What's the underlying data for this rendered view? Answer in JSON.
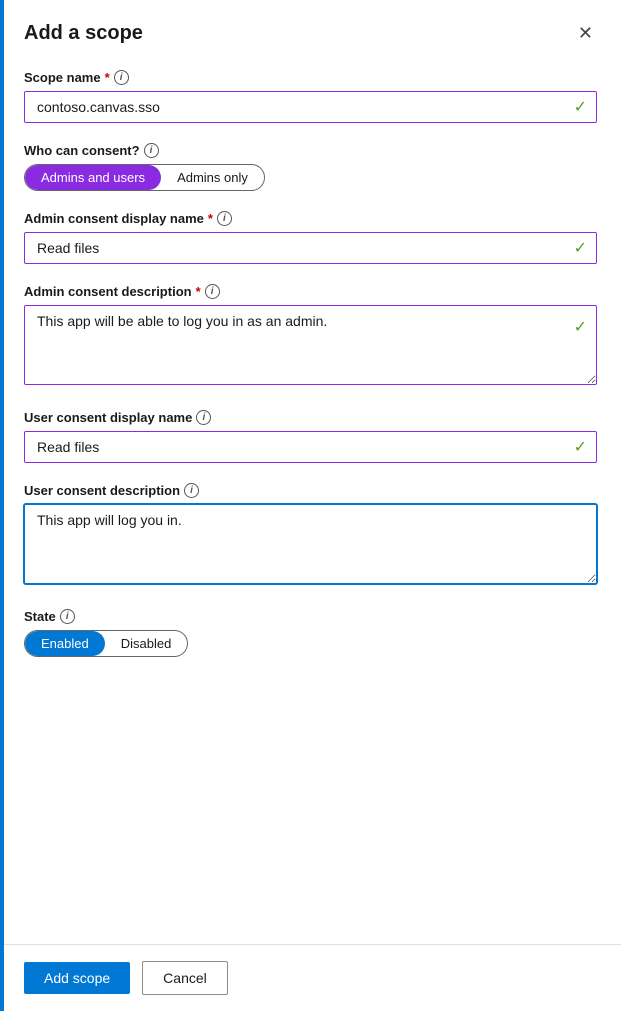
{
  "dialog": {
    "title": "Add a scope",
    "close_label": "✕"
  },
  "form": {
    "scope_name_label": "Scope name",
    "scope_name_value": "contoso.canvas.sso",
    "who_can_consent_label": "Who can consent?",
    "consent_option1": "Admins and users",
    "consent_option2": "Admins only",
    "admin_consent_display_name_label": "Admin consent display name",
    "admin_consent_display_name_value": "Read files",
    "admin_consent_description_label": "Admin consent description",
    "admin_consent_description_value": "This app will be able to log you in as an admin.",
    "user_consent_display_name_label": "User consent display name",
    "user_consent_display_name_value": "Read files",
    "user_consent_description_label": "User consent description",
    "user_consent_description_value": "This app will log you in.",
    "state_label": "State",
    "state_option1": "Enabled",
    "state_option2": "Disabled"
  },
  "footer": {
    "add_scope_label": "Add scope",
    "cancel_label": "Cancel"
  },
  "icons": {
    "info": "i",
    "check": "✓",
    "close": "✕"
  }
}
